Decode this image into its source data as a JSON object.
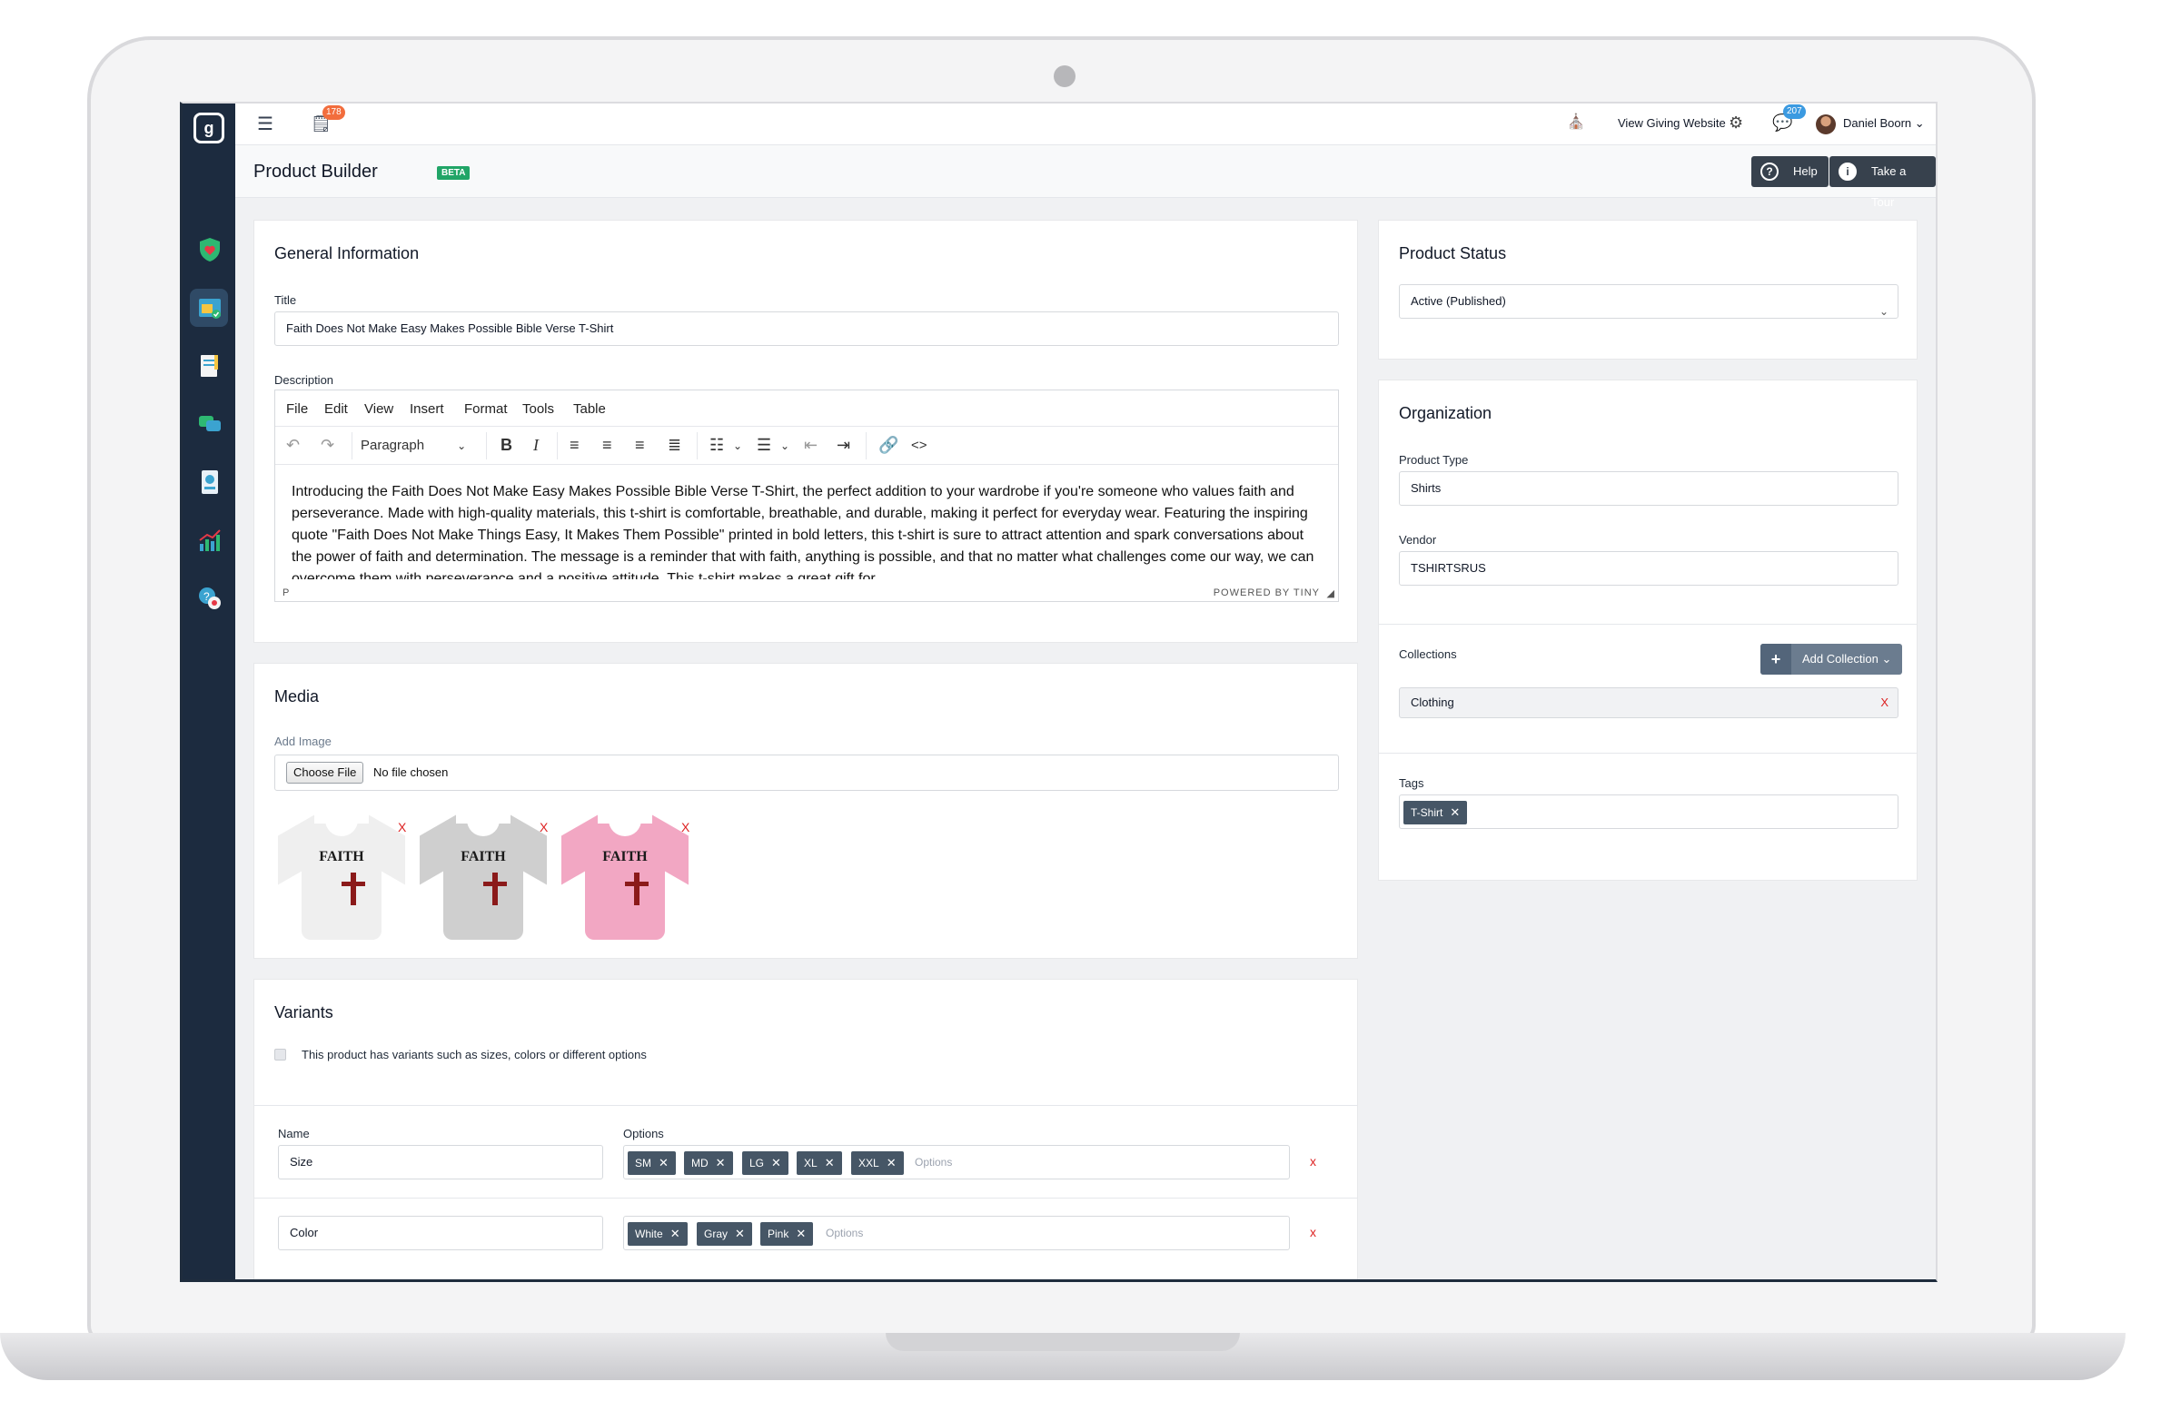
{
  "topbar": {
    "notification_count": "178",
    "view_website": "View Giving Website",
    "messages_count": "207",
    "user_name": "Daniel Boorn"
  },
  "header": {
    "title": "Product Builder",
    "beta": "BETA",
    "help": "Help",
    "tour": "Take a Tour"
  },
  "general": {
    "heading": "General Information",
    "title_label": "Title",
    "title_value": "Faith Does Not Make Easy Makes Possible Bible Verse T-Shirt",
    "description_label": "Description",
    "menu": [
      "File",
      "Edit",
      "View",
      "Insert",
      "Format",
      "Tools",
      "Table"
    ],
    "block_format": "Paragraph",
    "description_text": "Introducing the Faith Does Not Make Easy Makes Possible Bible Verse T-Shirt, the perfect addition to your wardrobe if you're someone who values faith and perseverance. Made with high-quality materials, this t-shirt is comfortable, breathable, and durable, making it perfect for everyday wear. Featuring the inspiring quote \"Faith Does Not Make Things Easy, It Makes Them Possible\" printed in bold letters, this t-shirt is sure to attract attention and spark conversations about the power of faith and determination. The message is a reminder that with faith, anything is possible, and that no matter what challenges come our way, we can overcome them with perseverance and a positive attitude. This t-shirt makes a great gift for",
    "status_path": "P",
    "powered_by": "POWERED BY TINY"
  },
  "media": {
    "heading": "Media",
    "add_image": "Add Image",
    "choose_file": "Choose File",
    "no_file": "No file chosen",
    "shirt_title": "FAITH",
    "remove": "X",
    "images": [
      {
        "name": "White",
        "color": "#efefef"
      },
      {
        "name": "Gray",
        "color": "#cfcfcf"
      },
      {
        "name": "Pink",
        "color": "#f2a7c3"
      }
    ]
  },
  "variants": {
    "heading": "Variants",
    "has_variants_label": "This product has variants such as sizes, colors or different options",
    "name_header": "Name",
    "options_header": "Options",
    "options_placeholder": "Options",
    "remove": "x",
    "rows": [
      {
        "name": "Size",
        "options": [
          "SM",
          "MD",
          "LG",
          "XL",
          "XXL"
        ]
      },
      {
        "name": "Color",
        "options": [
          "White",
          "Gray",
          "Pink"
        ]
      }
    ]
  },
  "status": {
    "heading": "Product Status",
    "value": "Active (Published)"
  },
  "organization": {
    "heading": "Organization",
    "type_label": "Product Type",
    "type_value": "Shirts",
    "vendor_label": "Vendor",
    "vendor_value": "TSHIRTSRUS",
    "collections_label": "Collections",
    "add_collection": "Add Collection",
    "collections": [
      "Clothing"
    ],
    "collection_remove": "X",
    "tags_label": "Tags",
    "tags": [
      "T-Shirt"
    ]
  },
  "colors": {
    "sidebar": "#1c2b3f",
    "accent_green": "#21a567",
    "tag_bg": "#465666",
    "badge_orange": "#f26d3d",
    "badge_blue": "#3b9ae1"
  }
}
